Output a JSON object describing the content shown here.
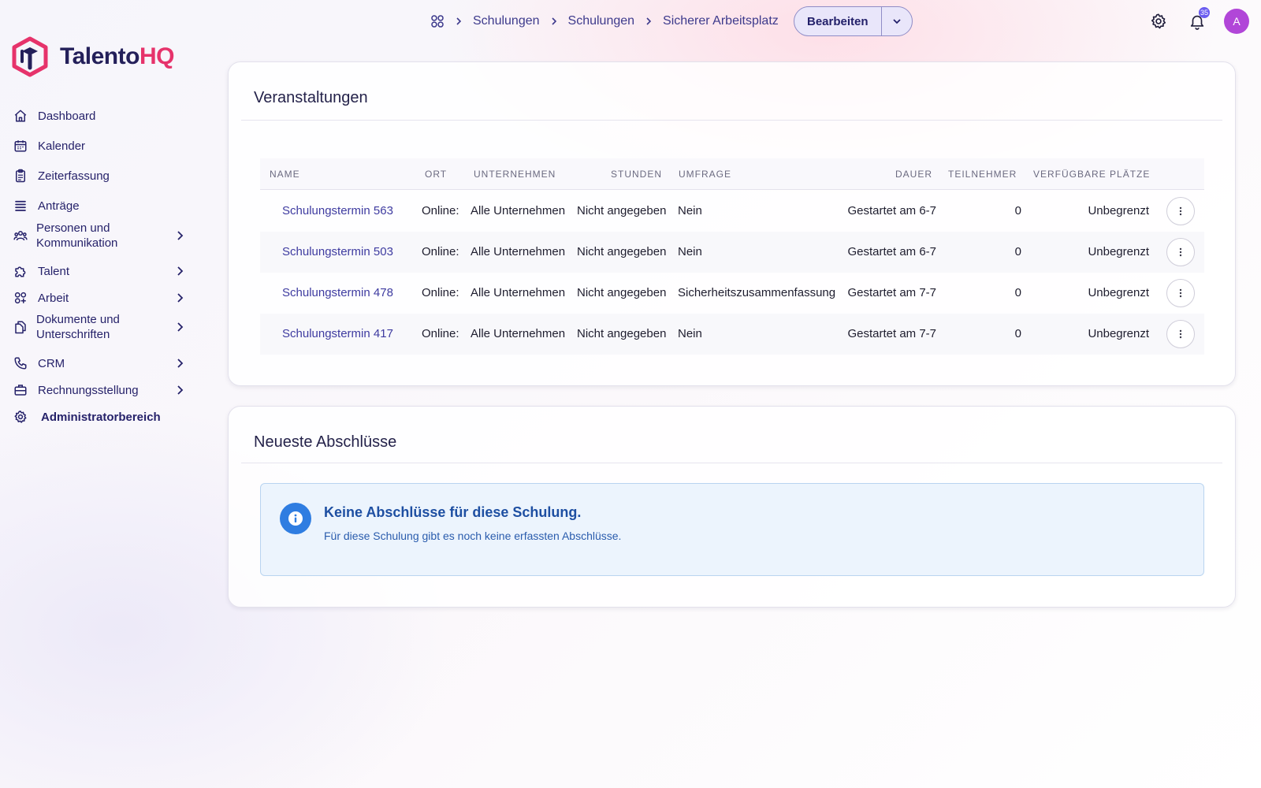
{
  "brand": {
    "name_part1": "Talento",
    "name_part2": "HQ",
    "accent": "#e6336b",
    "primary": "#24205a"
  },
  "sidebar": {
    "items": [
      {
        "label": "Dashboard",
        "icon": "home-icon",
        "expandable": false
      },
      {
        "label": "Kalender",
        "icon": "calendar-icon",
        "expandable": false
      },
      {
        "label": "Zeiterfassung",
        "icon": "clipboard-icon",
        "expandable": false
      },
      {
        "label": "Anträge",
        "icon": "list-icon",
        "expandable": false
      },
      {
        "label": "Personen und Kommunikation",
        "icon": "users-icon",
        "expandable": true
      },
      {
        "label": "Talent",
        "icon": "puzzle-icon",
        "expandable": true
      },
      {
        "label": "Arbeit",
        "icon": "apps-icon",
        "expandable": true
      },
      {
        "label": "Dokumente und Unterschriften",
        "icon": "documents-icon",
        "expandable": true
      },
      {
        "label": "CRM",
        "icon": "phone-icon",
        "expandable": true
      },
      {
        "label": "Rechnungsstellung",
        "icon": "briefcase-icon",
        "expandable": true
      },
      {
        "label": "Administratorbereich",
        "icon": "gear-icon",
        "expandable": false
      }
    ]
  },
  "breadcrumb": [
    "Schulungen",
    "Schulungen",
    "Sicherer Arbeitsplatz"
  ],
  "toolbar": {
    "edit_label": "Bearbeiten"
  },
  "header": {
    "notification_count": "35",
    "avatar_initial": "A"
  },
  "events": {
    "title": "Veranstaltungen",
    "columns": [
      "NAME",
      "ORT",
      "UNTERNEHMEN",
      "STUNDEN",
      "UMFRAGE",
      "DAUER",
      "TEILNEHMER",
      "VERFÜGBARE PLÄTZE"
    ],
    "rows": [
      {
        "name": "Schulungstermin 563",
        "location": "Online:",
        "company": "Alle Unternehmen",
        "hours": "Nicht angegeben",
        "survey": "Nein",
        "duration": "Gestartet am 6-7",
        "participants": "0",
        "seats": "Unbegrenzt"
      },
      {
        "name": "Schulungstermin 503",
        "location": "Online:",
        "company": "Alle Unternehmen",
        "hours": "Nicht angegeben",
        "survey": "Nein",
        "duration": "Gestartet am 6-7",
        "participants": "0",
        "seats": "Unbegrenzt"
      },
      {
        "name": "Schulungstermin 478",
        "location": "Online:",
        "company": "Alle Unternehmen",
        "hours": "Nicht angegeben",
        "survey": "Sicherheitszusammenfassung",
        "duration": "Gestartet am 7-7",
        "participants": "0",
        "seats": "Unbegrenzt"
      },
      {
        "name": "Schulungstermin 417",
        "location": "Online:",
        "company": "Alle Unternehmen",
        "hours": "Nicht angegeben",
        "survey": "Nein",
        "duration": "Gestartet am 7-7",
        "participants": "0",
        "seats": "Unbegrenzt"
      }
    ]
  },
  "completions": {
    "title": "Neueste Abschlüsse",
    "empty_title": "Keine Abschlüsse für diese Schulung.",
    "empty_text": "Für diese Schulung gibt es noch keine erfassten Abschlüsse."
  }
}
